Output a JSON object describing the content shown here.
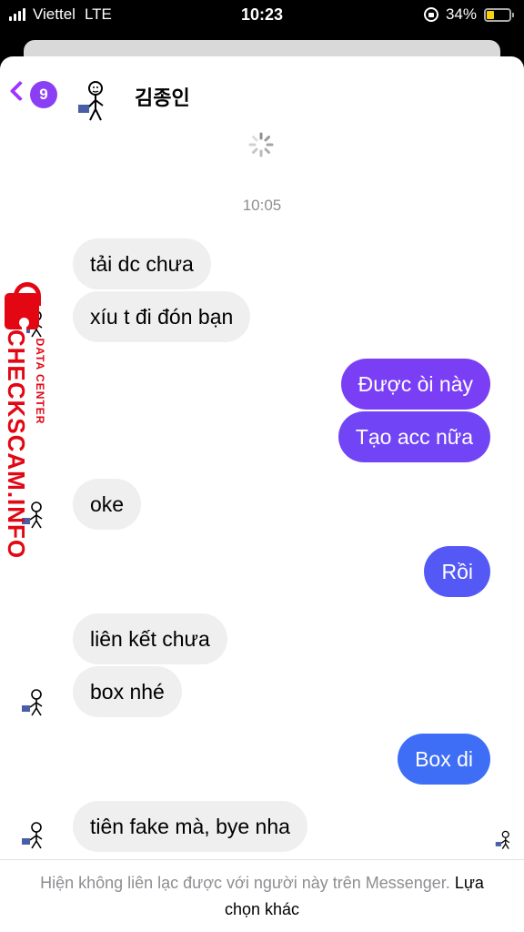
{
  "status_bar": {
    "carrier": "Viettel",
    "network": "LTE",
    "time": "10:23",
    "battery": "34%",
    "battery_level": 0.34,
    "icons": [
      "signal-bars-icon",
      "rotation-lock-icon",
      "battery-icon"
    ]
  },
  "header": {
    "back_count": "9",
    "contact_name": "김종인",
    "icons": [
      "back-chevron-icon",
      "contact-avatar"
    ]
  },
  "conversation": {
    "timestamp": "10:05",
    "messages": [
      {
        "side": "in",
        "text": "tải dc chưa"
      },
      {
        "side": "in",
        "text": "xíu t đi đón bạn"
      },
      {
        "side": "out",
        "text": "Được òi này"
      },
      {
        "side": "out",
        "text": "Tạo acc nữa"
      },
      {
        "side": "in",
        "text": "oke"
      },
      {
        "side": "out",
        "text": "Rồi"
      },
      {
        "side": "in",
        "text": "liên kết chưa"
      },
      {
        "side": "in",
        "text": "box nhé"
      },
      {
        "side": "out",
        "text": "Box di"
      },
      {
        "side": "in",
        "text": "tiên fake mà, bye nha"
      }
    ]
  },
  "watermark": {
    "big": "CHECKSCAM.INFO",
    "small": "DATA CENTER"
  },
  "footer": {
    "notice": "Hiện không liên lạc được với người này trên Messenger.",
    "link": "Lựa chọn khác"
  },
  "colors": {
    "accent": "#a033ff",
    "bubble_in": "#efefef",
    "bubble_out_purple": "#7b40f5",
    "bubble_out_blue": "#3d6ef5",
    "watermark_red": "#e30613"
  }
}
